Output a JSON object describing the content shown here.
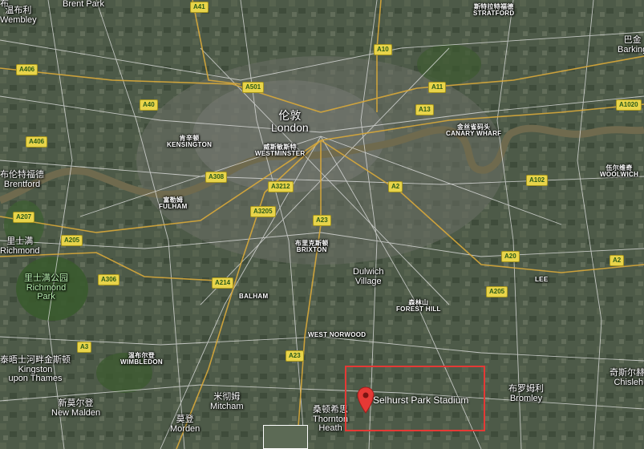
{
  "map": {
    "poi": {
      "name": "Selhurst Park Stadium",
      "icon": "map-pin-icon",
      "highlight_color": "#e53935"
    },
    "city": {
      "zh": "伦敦",
      "en": "London"
    },
    "labels": [
      {
        "id": "brent-park",
        "lines": [
          "Brent Park"
        ],
        "cls": "place"
      },
      {
        "id": "stratford",
        "lines": [
          "斯特拉特福德",
          "STRATFORD"
        ],
        "cls": "district"
      },
      {
        "id": "barking",
        "lines": [
          "巴金",
          "Barking"
        ],
        "cls": "place"
      },
      {
        "id": "kensington",
        "lines": [
          "肯辛顿",
          "KENSINGTON"
        ],
        "cls": "district"
      },
      {
        "id": "westminster",
        "lines": [
          "威斯敏斯特",
          "WESTMINSTER"
        ],
        "cls": "district"
      },
      {
        "id": "canary-wharf",
        "lines": [
          "金丝雀码头",
          "CANARY WHARF"
        ],
        "cls": "district"
      },
      {
        "id": "woolwich",
        "lines": [
          "伍尔维奇",
          "WOOLWICH"
        ],
        "cls": "district"
      },
      {
        "id": "fulham",
        "lines": [
          "富勒姆",
          "FULHAM"
        ],
        "cls": "district"
      },
      {
        "id": "brixton",
        "lines": [
          "布里克斯顿",
          "BRIXTON"
        ],
        "cls": "district"
      },
      {
        "id": "dulwich",
        "lines": [
          "Dulwich",
          "Village"
        ],
        "cls": "place"
      },
      {
        "id": "richmond-park",
        "lines": [
          "里士满公园",
          "Richmond",
          "Park"
        ],
        "cls": "place green"
      },
      {
        "id": "balham",
        "lines": [
          "BALHAM"
        ],
        "cls": "district"
      },
      {
        "id": "forest-hill",
        "lines": [
          "森林山",
          "FOREST HILL"
        ],
        "cls": "district"
      },
      {
        "id": "lee",
        "lines": [
          "LEE"
        ],
        "cls": "district"
      },
      {
        "id": "west-norwood",
        "lines": [
          "WEST NORWOOD"
        ],
        "cls": "district"
      },
      {
        "id": "wimbledon",
        "lines": [
          "温布尔登",
          "WIMBLEDON"
        ],
        "cls": "district"
      },
      {
        "id": "mitcham",
        "lines": [
          "米彻姆",
          "Mitcham"
        ],
        "cls": "place"
      },
      {
        "id": "thornton-heath",
        "lines": [
          "桑顿希思",
          "Thornton",
          "Heath"
        ],
        "cls": "place"
      },
      {
        "id": "new-malden",
        "lines": [
          "新莫尔登",
          "New Malden"
        ],
        "cls": "place"
      },
      {
        "id": "morden",
        "lines": [
          "莫登",
          "Morden"
        ],
        "cls": "place"
      },
      {
        "id": "bromley",
        "lines": [
          "布罗姆利",
          "Bromley"
        ],
        "cls": "place"
      },
      {
        "id": "chislehurst",
        "lines": [
          "奇斯尔赫斯特",
          "Chislehurst"
        ],
        "cls": "place"
      },
      {
        "id": "kingston-thames",
        "lines": [
          "泰晤士河畔金斯顿",
          "Kingston",
          "upon Thames"
        ],
        "cls": "place"
      },
      {
        "id": "richmond",
        "lines": [
          "里士满",
          "Richmond"
        ],
        "cls": "place"
      },
      {
        "id": "brentford",
        "lines": [
          "布伦特福德",
          "Brentford"
        ],
        "cls": "place"
      },
      {
        "id": "wembley",
        "lines": [
          "温布利",
          "Wembley"
        ],
        "cls": "place"
      }
    ],
    "roads": [
      "A41",
      "A10",
      "A406",
      "A501",
      "A11",
      "A40",
      "A13",
      "A1020",
      "A308",
      "A3212",
      "A102",
      "A207",
      "A3205",
      "A2",
      "A23",
      "A205",
      "A20",
      "A306",
      "A214",
      "A205",
      "A3",
      "A23",
      "A2"
    ]
  }
}
